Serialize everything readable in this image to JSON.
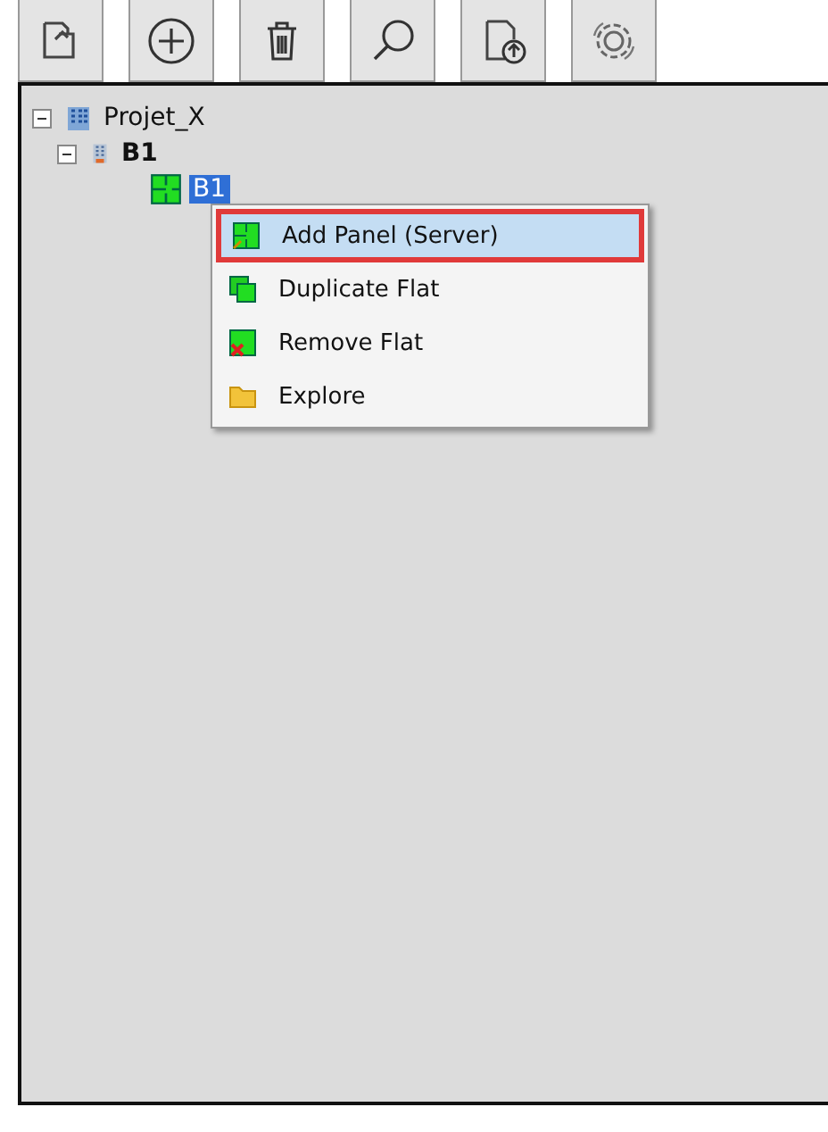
{
  "toolbar": [
    {
      "kind": "import"
    },
    {
      "kind": "add"
    },
    {
      "kind": "delete"
    },
    {
      "kind": "search"
    },
    {
      "kind": "upload"
    },
    {
      "kind": "settings"
    }
  ],
  "tree": [
    {
      "label": "Projet_X",
      "kind": "project",
      "expanded": true,
      "selected": false,
      "children": [
        {
          "label": "B1",
          "kind": "building",
          "expanded": true,
          "selected": false,
          "children": [
            {
              "label": "B1",
              "kind": "flat",
              "selected": true
            }
          ]
        }
      ]
    }
  ],
  "context_menu": [
    {
      "label": "Add Panel (Server)",
      "kind": "add-panel",
      "highlighted": true
    },
    {
      "label": "Duplicate Flat",
      "kind": "duplicate",
      "highlighted": false
    },
    {
      "label": "Remove Flat",
      "kind": "remove",
      "highlighted": false
    },
    {
      "label": "Explore",
      "kind": "folder",
      "highlighted": false
    }
  ]
}
